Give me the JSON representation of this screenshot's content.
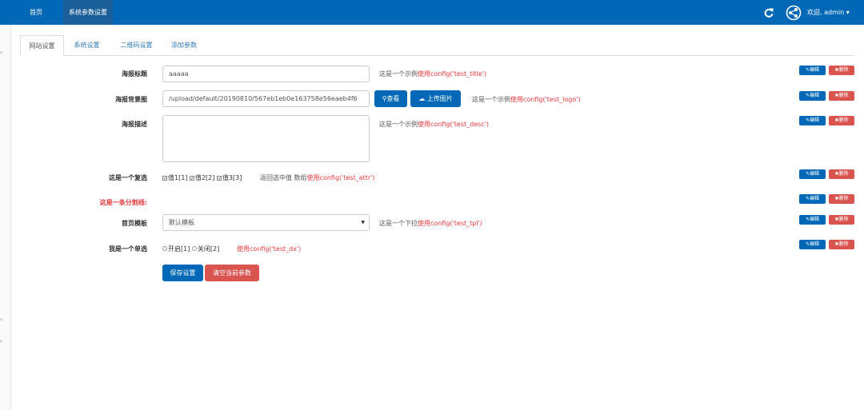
{
  "topnav": {
    "home": "首页",
    "system_params": "系统参数设置",
    "user": "欢迎, admin"
  },
  "tabs": [
    "网站设置",
    "系统设置",
    "二维码设置",
    "添加参数"
  ],
  "form": {
    "poster_title": {
      "label": "海报标题",
      "value": "aaaaa",
      "hint_prefix": "这是一个示例",
      "hint_code": "使用config('test_title')"
    },
    "poster_bg": {
      "label": "海报背景图",
      "value": "/upload/default/20190810/567eb1eb0e163758e56eaeb4f6",
      "view_label": "查看",
      "upload_label": "上传图片",
      "hint_prefix": "这是一个示例",
      "hint_code": "使用config('test_logo')"
    },
    "poster_desc": {
      "label": "海报描述",
      "value": "",
      "hint_prefix": "这是一个示例",
      "hint_code": "使用config('test_desc')"
    },
    "checkbox": {
      "label": "这是一个复选",
      "options": [
        "值1[1]",
        "值2[2]",
        "值3[3]"
      ],
      "hint_prefix": "返回选中值 数组",
      "hint_code": "使用config('test_attr')"
    },
    "divider": {
      "label": "这是一条分割线:"
    },
    "home_template": {
      "label": "首页模板",
      "selected": "默认模板",
      "hint_prefix": "这是一个下拉",
      "hint_code": "使用config('test_tpl')"
    },
    "radio": {
      "label": "我是一个单选",
      "options": [
        "开启[1]",
        "关闭[2]"
      ],
      "hint_code": "使用config('test_dx')"
    }
  },
  "row_actions": {
    "edit": "编辑",
    "delete": "删除"
  },
  "buttons": {
    "save": "保存设置",
    "clear": "清空当前参数"
  },
  "colors": {
    "primary": "#0068b7",
    "danger": "#d9534f",
    "hint_red": "#e4393c"
  }
}
